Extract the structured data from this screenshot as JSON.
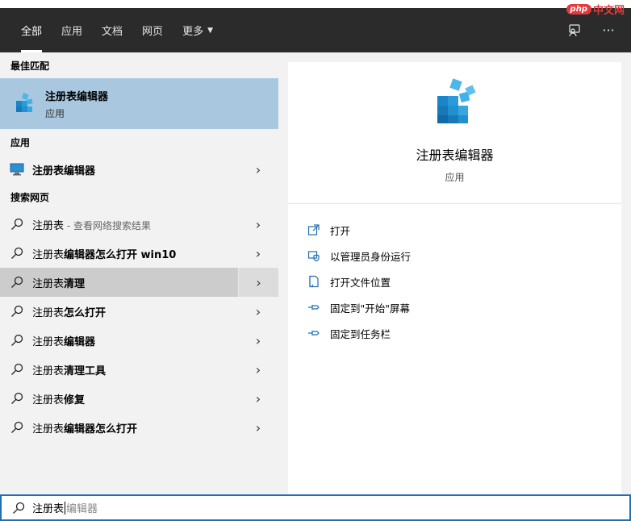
{
  "watermark": {
    "php": "php",
    "cn": "中文网"
  },
  "header": {
    "tabs": [
      {
        "label": "全部",
        "active": true
      },
      {
        "label": "应用",
        "active": false
      },
      {
        "label": "文档",
        "active": false
      },
      {
        "label": "网页",
        "active": false
      },
      {
        "label": "更多",
        "active": false
      }
    ],
    "feedback_icon": "feedback-icon",
    "more_icon": "ellipsis-icon"
  },
  "left": {
    "best_match_title": "最佳匹配",
    "best_match": {
      "name": "注册表编辑器",
      "type": "应用",
      "icon": "registry-editor-icon"
    },
    "apps_title": "应用",
    "apps": [
      {
        "name": "注册表编辑器",
        "icon": "monitor-icon"
      }
    ],
    "web_title": "搜索网页",
    "web_results": [
      {
        "normal": "注册表",
        "bold": "",
        "suffix": " - 查看网络搜索结果"
      },
      {
        "normal": "注册表",
        "bold": "编辑器怎么打开 win10",
        "suffix": ""
      },
      {
        "normal": "注册表",
        "bold": "清理",
        "suffix": ""
      },
      {
        "normal": "注册表",
        "bold": "怎么打开",
        "suffix": ""
      },
      {
        "normal": "注册表",
        "bold": "编辑器",
        "suffix": ""
      },
      {
        "normal": "注册表",
        "bold": "清理工具",
        "suffix": ""
      },
      {
        "normal": "注册表",
        "bold": "修复",
        "suffix": ""
      },
      {
        "normal": "注册表",
        "bold": "编辑器怎么打开",
        "suffix": ""
      }
    ]
  },
  "right": {
    "title": "注册表编辑器",
    "subtitle": "应用",
    "actions": [
      {
        "label": "打开",
        "icon": "open-icon"
      },
      {
        "label": "以管理员身份运行",
        "icon": "shield-icon"
      },
      {
        "label": "打开文件位置",
        "icon": "file-location-icon"
      },
      {
        "label": "固定到\"开始\"屏幕",
        "icon": "pin-icon"
      },
      {
        "label": "固定到任务栏",
        "icon": "pin-icon"
      }
    ]
  },
  "search": {
    "typed": "注册表",
    "suggestion": "编辑器"
  },
  "colors": {
    "header_bg": "#2b2b2b",
    "selected_bg": "#a9c8e0",
    "hover_bg": "#cccccc",
    "accent": "#1f6fb5"
  }
}
